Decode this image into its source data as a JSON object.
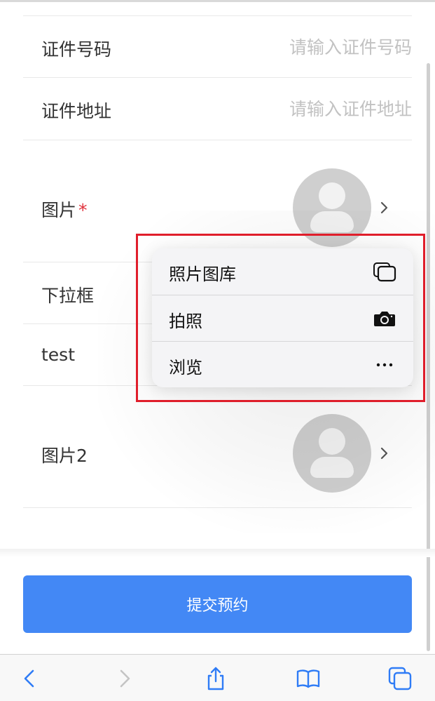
{
  "form": {
    "id_number": {
      "label": "证件号码",
      "placeholder": "请输入证件号码",
      "value": ""
    },
    "id_address": {
      "label": "证件地址",
      "placeholder": "请输入证件地址",
      "value": ""
    },
    "image": {
      "label": "图片",
      "required_mark": "*"
    },
    "dropdown": {
      "label": "下拉框"
    },
    "test_field": {
      "label": "test"
    },
    "image2": {
      "label": "图片2"
    }
  },
  "menu": {
    "items": [
      {
        "label": "照片图库",
        "icon": "photo-library-icon"
      },
      {
        "label": "拍照",
        "icon": "camera-icon"
      },
      {
        "label": "浏览",
        "icon": "more-icon"
      }
    ]
  },
  "submit": {
    "label": "提交预约"
  },
  "toolbar": {
    "icons": [
      "back-icon",
      "forward-icon",
      "share-icon",
      "bookmarks-icon",
      "tabs-icon"
    ]
  },
  "colors": {
    "accent": "#4388f5",
    "required": "#e0303a",
    "highlight": "#e01e2b",
    "ios_blue": "#2f7cf6"
  }
}
